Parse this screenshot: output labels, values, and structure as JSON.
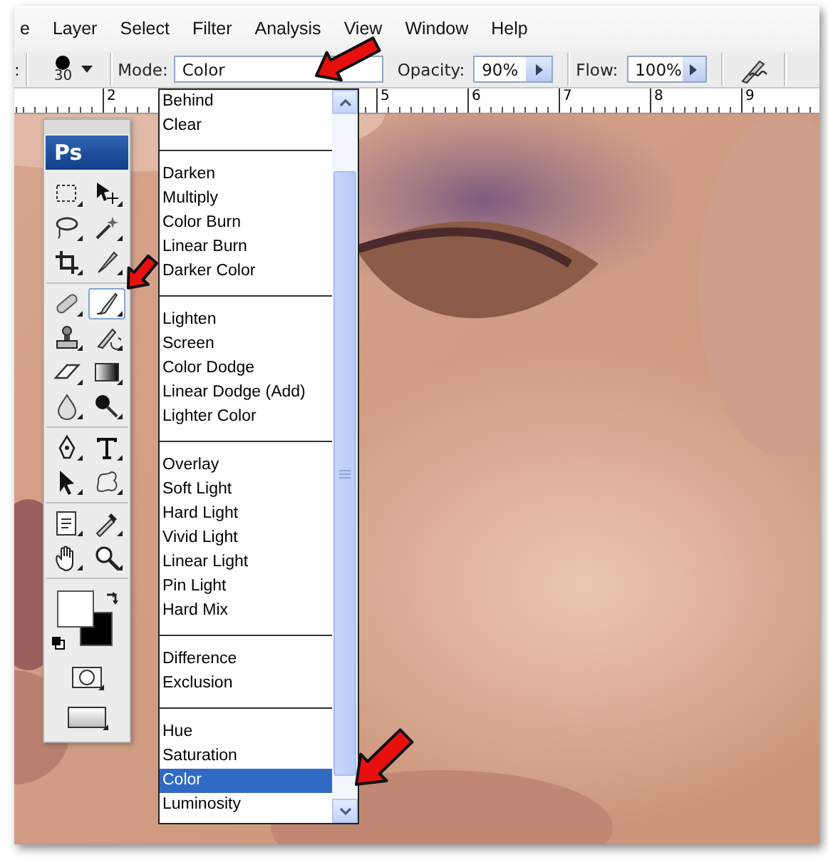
{
  "menubar": {
    "items": [
      {
        "label": "e"
      },
      {
        "label": "Layer"
      },
      {
        "label": "Select"
      },
      {
        "label": "Filter"
      },
      {
        "label": "Analysis"
      },
      {
        "label": "View"
      },
      {
        "label": "Window"
      },
      {
        "label": "Help"
      }
    ]
  },
  "options": {
    "brush_label": ":",
    "brush_size": "30",
    "mode_label": "Mode:",
    "mode_value": "Color",
    "opacity_label": "Opacity:",
    "opacity_value": "90%",
    "flow_label": "Flow:",
    "flow_value": "100%"
  },
  "ruler": {
    "labels": [
      "2",
      "5",
      "6",
      "7",
      "8",
      "9"
    ]
  },
  "toolbox": {
    "logo": "Ps",
    "groups": [
      [
        {
          "kind": "marquee",
          "selected": false
        },
        {
          "kind": "move",
          "selected": false
        },
        {
          "kind": "lasso",
          "selected": false
        },
        {
          "kind": "wand",
          "selected": false
        },
        {
          "kind": "crop",
          "selected": false
        },
        {
          "kind": "slice",
          "selected": false
        }
      ],
      [
        {
          "kind": "heal",
          "selected": false
        },
        {
          "kind": "brush",
          "selected": true
        },
        {
          "kind": "stamp",
          "selected": false
        },
        {
          "kind": "history",
          "selected": false
        },
        {
          "kind": "eraser",
          "selected": false
        },
        {
          "kind": "gradient",
          "selected": false
        },
        {
          "kind": "blur",
          "selected": false
        },
        {
          "kind": "dodge",
          "selected": false
        }
      ],
      [
        {
          "kind": "pen",
          "selected": false
        },
        {
          "kind": "type",
          "selected": false
        },
        {
          "kind": "pathselect",
          "selected": false
        },
        {
          "kind": "shape",
          "selected": false
        }
      ],
      [
        {
          "kind": "notes",
          "selected": false
        },
        {
          "kind": "eyedropper",
          "selected": false
        },
        {
          "kind": "hand",
          "selected": false
        },
        {
          "kind": "zoom",
          "selected": false
        }
      ]
    ]
  },
  "mode_list": {
    "groups": [
      [
        {
          "label": "Behind",
          "selected": false
        },
        {
          "label": "Clear",
          "selected": false
        }
      ],
      [
        {
          "label": "Darken",
          "selected": false
        },
        {
          "label": "Multiply",
          "selected": false
        },
        {
          "label": "Color Burn",
          "selected": false
        },
        {
          "label": "Linear Burn",
          "selected": false
        },
        {
          "label": "Darker Color",
          "selected": false
        }
      ],
      [
        {
          "label": "Lighten",
          "selected": false
        },
        {
          "label": "Screen",
          "selected": false
        },
        {
          "label": "Color Dodge",
          "selected": false
        },
        {
          "label": "Linear Dodge (Add)",
          "selected": false
        },
        {
          "label": "Lighter Color",
          "selected": false
        }
      ],
      [
        {
          "label": "Overlay",
          "selected": false
        },
        {
          "label": "Soft Light",
          "selected": false
        },
        {
          "label": "Hard Light",
          "selected": false
        },
        {
          "label": "Vivid Light",
          "selected": false
        },
        {
          "label": "Linear Light",
          "selected": false
        },
        {
          "label": "Pin Light",
          "selected": false
        },
        {
          "label": "Hard Mix",
          "selected": false
        }
      ],
      [
        {
          "label": "Difference",
          "selected": false
        },
        {
          "label": "Exclusion",
          "selected": false
        }
      ],
      [
        {
          "label": "Hue",
          "selected": false
        },
        {
          "label": "Saturation",
          "selected": false
        },
        {
          "label": "Color",
          "selected": true
        },
        {
          "label": "Luminosity",
          "selected": false
        }
      ]
    ]
  }
}
